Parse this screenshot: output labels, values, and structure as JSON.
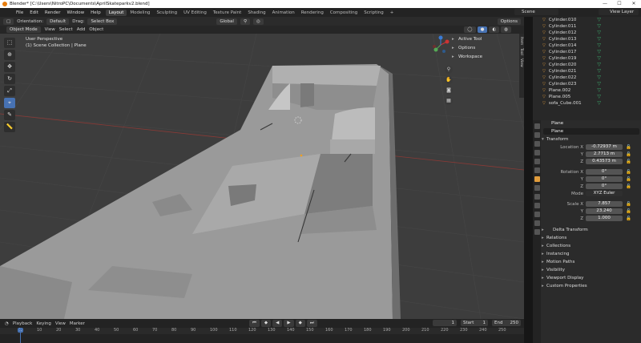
{
  "window": {
    "title": "Blender* [C:\\Users\\NitroPC\\Documents\\AprilSkateparkv2.blend]",
    "min": "—",
    "max": "☐",
    "close": "✕"
  },
  "menu": [
    "File",
    "Edit",
    "Render",
    "Window",
    "Help"
  ],
  "workspaces": [
    "Layout",
    "Modeling",
    "Sculpting",
    "UV Editing",
    "Texture Paint",
    "Shading",
    "Animation",
    "Rendering",
    "Compositing",
    "Scripting",
    "+"
  ],
  "scene": {
    "label": "Scene",
    "view_layer": "View Layer"
  },
  "tool_header": {
    "orientation_label": "Orientation:",
    "orientation": "Default",
    "drag_label": "Drag:",
    "drag": "Select Box",
    "transform": "Global",
    "options": "Options"
  },
  "viewport_header": {
    "mode": "Object Mode",
    "menus": [
      "View",
      "Select",
      "Add",
      "Object"
    ]
  },
  "viewport": {
    "perspective": "User Perspective",
    "collection": "(1) Scene Collection | Plane"
  },
  "npanel": [
    "Active Tool",
    "Options",
    "Workspace"
  ],
  "npanel_tabs": [
    "Item",
    "Tool",
    "View"
  ],
  "toolbar_icons": [
    "select-box-icon",
    "cursor-icon",
    "move-icon",
    "rotate-icon",
    "scale-icon",
    "transform-icon",
    "annotate-icon",
    "measure-icon"
  ],
  "outliner": [
    "Cylinder.010",
    "Cylinder.011",
    "Cylinder.012",
    "Cylinder.013",
    "Cylinder.014",
    "Cylinder.017",
    "Cylinder.019",
    "Cylinder.020",
    "Cylinder.021",
    "Cylinder.022",
    "Cylinder.023",
    "Plane.002",
    "Plane.005",
    "sofa_Cube.001"
  ],
  "properties": {
    "object": "Plane",
    "name": "Plane",
    "transform_label": "Transform",
    "location": {
      "label": "Location X",
      "x": "-0.72937 m",
      "y": "2.7713 m",
      "z": "0.43573 m"
    },
    "rotation": {
      "label": "Rotation X",
      "x": "0°",
      "y": "0°",
      "z": "0°"
    },
    "mode": {
      "label": "Mode",
      "value": "XYZ Euler"
    },
    "scale": {
      "label": "Scale X",
      "x": "7.857",
      "y": "23.240",
      "z": "1.000"
    },
    "y": "Y",
    "z": "Z",
    "delta": "Delta Transform",
    "sections": [
      "Relations",
      "Collections",
      "Instancing",
      "Motion Paths",
      "Visibility",
      "Viewport Display",
      "Custom Properties"
    ]
  },
  "timeline": {
    "menus": [
      "Playback",
      "Keying",
      "View",
      "Marker"
    ],
    "current": "1",
    "start_label": "Start",
    "start": "1",
    "end_label": "End",
    "end": "250",
    "ticks": [
      "1",
      "10",
      "20",
      "30",
      "40",
      "50",
      "60",
      "70",
      "80",
      "90",
      "100",
      "110",
      "120",
      "130",
      "140",
      "150",
      "160",
      "170",
      "180",
      "190",
      "200",
      "210",
      "220",
      "230",
      "240",
      "250"
    ]
  },
  "colors": {
    "accent": "#4772b3",
    "mesh_orange": "#e09c3c",
    "vertex_green": "#3cb371",
    "axis_red": "#a0352f"
  }
}
